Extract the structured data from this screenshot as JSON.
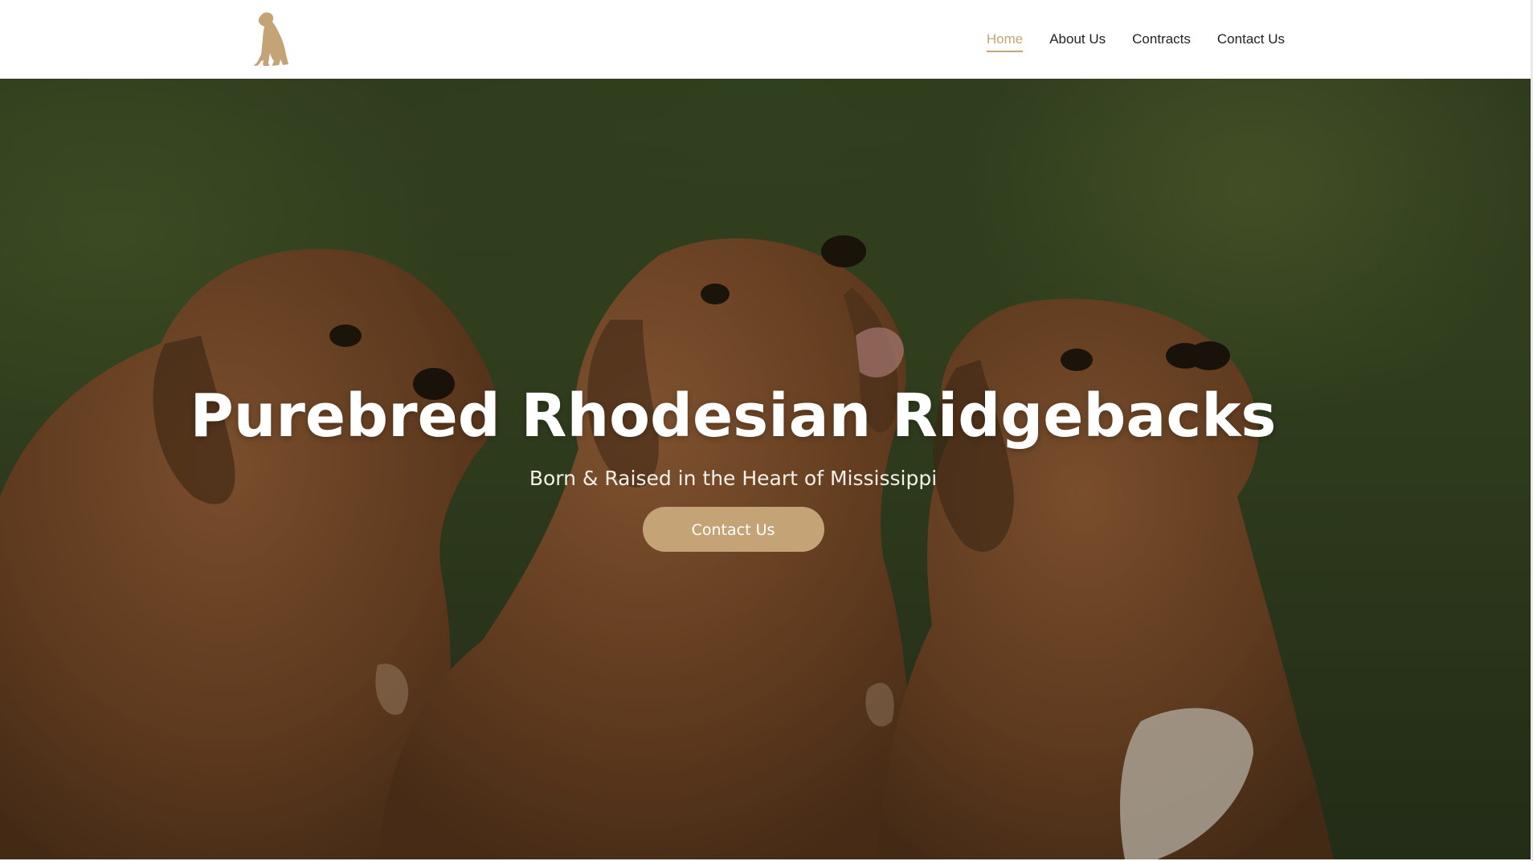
{
  "colors": {
    "accent": "#c4a477",
    "nav_text": "#222222",
    "header_bg": "#ffffff",
    "hero_text": "#ffffff"
  },
  "header": {
    "logo_icon": "sitting-dog-silhouette-icon",
    "nav": {
      "items": [
        {
          "label": "Home",
          "active": true
        },
        {
          "label": "About Us",
          "active": false
        },
        {
          "label": "Contracts",
          "active": false
        },
        {
          "label": "Contact Us",
          "active": false
        }
      ]
    }
  },
  "hero": {
    "background": "puppies-on-grass-photo",
    "title": "Purebred Rhodesian Ridgebacks",
    "subtitle": "Born & Raised in the Heart of Mississippi",
    "cta_label": "Contact Us"
  }
}
